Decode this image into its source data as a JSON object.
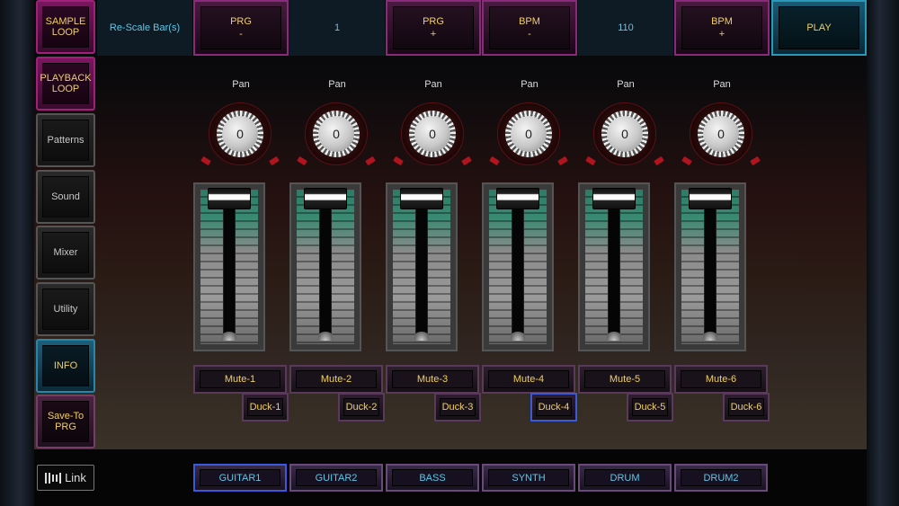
{
  "side_menu": [
    {
      "label": "SAMPLE\nLOOP",
      "style": "pink"
    },
    {
      "label": "PLAYBACK\nLOOP",
      "style": "pink"
    },
    {
      "label": "Patterns",
      "style": "gray"
    },
    {
      "label": "Sound",
      "style": "gray"
    },
    {
      "label": "Mixer",
      "style": "gray"
    },
    {
      "label": "Utility",
      "style": "gray"
    },
    {
      "label": "INFO",
      "style": "blue"
    },
    {
      "label": "Save-To\nPRG",
      "style": "mauve"
    }
  ],
  "top_bar": {
    "rescale_label": "Re-Scale Bar(s)",
    "prg_minus": "PRG\n-",
    "prg_value": "1",
    "prg_plus": "PRG\n+",
    "bpm_minus": "BPM\n-",
    "bpm_value": "110",
    "bpm_plus": "BPM\n+",
    "play": "PLAY"
  },
  "channels": [
    {
      "pan_label": "Pan",
      "pan_value": "0",
      "mute": "Mute-1",
      "duck": "Duck-1",
      "name": "GUITAR1"
    },
    {
      "pan_label": "Pan",
      "pan_value": "0",
      "mute": "Mute-2",
      "duck": "Duck-2",
      "name": "GUITAR2"
    },
    {
      "pan_label": "Pan",
      "pan_value": "0",
      "mute": "Mute-3",
      "duck": "Duck-3",
      "name": "BASS"
    },
    {
      "pan_label": "Pan",
      "pan_value": "0",
      "mute": "Mute-4",
      "duck": "Duck-4",
      "name": "SYNTH"
    },
    {
      "pan_label": "Pan",
      "pan_value": "0",
      "mute": "Mute-5",
      "duck": "Duck-5",
      "name": "DRUM"
    },
    {
      "pan_label": "Pan",
      "pan_value": "0",
      "mute": "Mute-6",
      "duck": "Duck-6",
      "name": "DRUM2"
    }
  ],
  "active_duck": 3,
  "active_channel": 0,
  "link_logo": {
    "text": "Link"
  },
  "colors": {
    "accent_yellow": "#f0d060",
    "accent_cyan": "#5ec8e8",
    "active_border": "#3a5adc"
  }
}
